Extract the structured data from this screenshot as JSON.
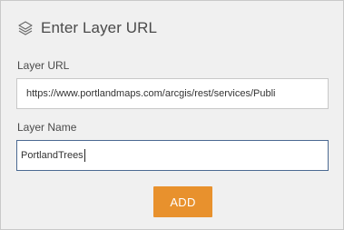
{
  "header": {
    "icon": "layers-icon",
    "title": "Enter Layer URL"
  },
  "form": {
    "layer_url": {
      "label": "Layer URL",
      "value": "https://www.portlandmaps.com/arcgis/rest/services/Publi"
    },
    "layer_name": {
      "label": "Layer Name",
      "value": "PortlandTrees"
    },
    "add_button_label": "ADD"
  },
  "colors": {
    "panel_background": "#f0f0f0",
    "accent_button": "#e8912d",
    "focused_border": "#4c6a92"
  }
}
